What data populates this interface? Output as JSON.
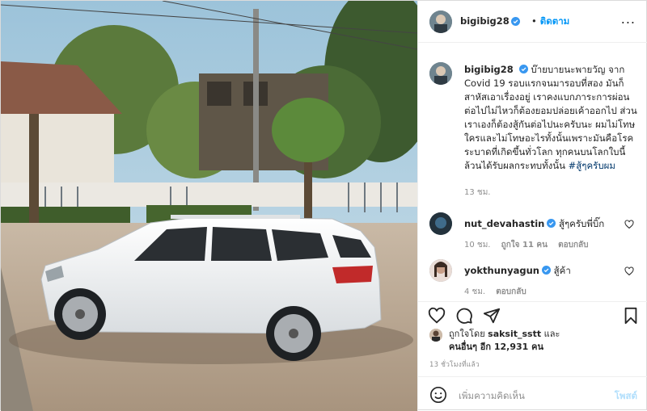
{
  "header": {
    "username": "bigibig28",
    "follow_dot": "•",
    "follow_label": "ติดตาม",
    "more_label": "..."
  },
  "caption": {
    "username": "bigibig28",
    "text": "บ๊ายบายนะพายวัญ จาก Covid 19 รอบแรกจนมารอบที่สอง มันก็สาหัสเอาเรื่องอยู่ เราคงแบกภาระการผ่อนต่อไปไม่ไหวก็ต้องยอมปล่อยเค้าออกไป ส่วนเราเองก็ต้องสู้กันต่อไปนะครับนะ ผมไม่โทษใครและไม่โทษอะไรทั้งนั้นเพราะมันคือโรคระบาดที่เกิดขึ้นทั่วโลก ทุกคนบนโลกใบนี้ล้วนได้รับผลกระทบทั้งนั้น",
    "hashtag": "#สู้ๆครับผม",
    "time": "13 ชม."
  },
  "comments": [
    {
      "username": "nut_devahastin",
      "text": "สู้ๆครับพี่บิ๊ก",
      "time": "10 ชม.",
      "likes": "ถูกใจ 11 คน",
      "reply": "ตอบกลับ"
    },
    {
      "username": "yokthunyagun",
      "text": "สู้ค้า",
      "time": "4 ชม.",
      "reply": "ตอบกลับ"
    }
  ],
  "likes": {
    "line1_prefix": "ถูกใจโดย",
    "liked_by": "saksit_sstt",
    "and": "และ",
    "line2": "คนอื่นๆ อีก 12,931 คน"
  },
  "posted_ago": "13 ชั่วโมงที่แล้ว",
  "add_comment": {
    "placeholder": "เพิ่มความคิดเห็น",
    "post_label": "โพสต์"
  },
  "colors": {
    "accent": "#0095f6",
    "verified": "#3897f0",
    "post_disabled": "#b2dffc"
  },
  "icons": [
    "more-icon",
    "verified-icon",
    "heart-icon",
    "comment-icon",
    "share-icon",
    "bookmark-icon",
    "emoji-icon"
  ]
}
